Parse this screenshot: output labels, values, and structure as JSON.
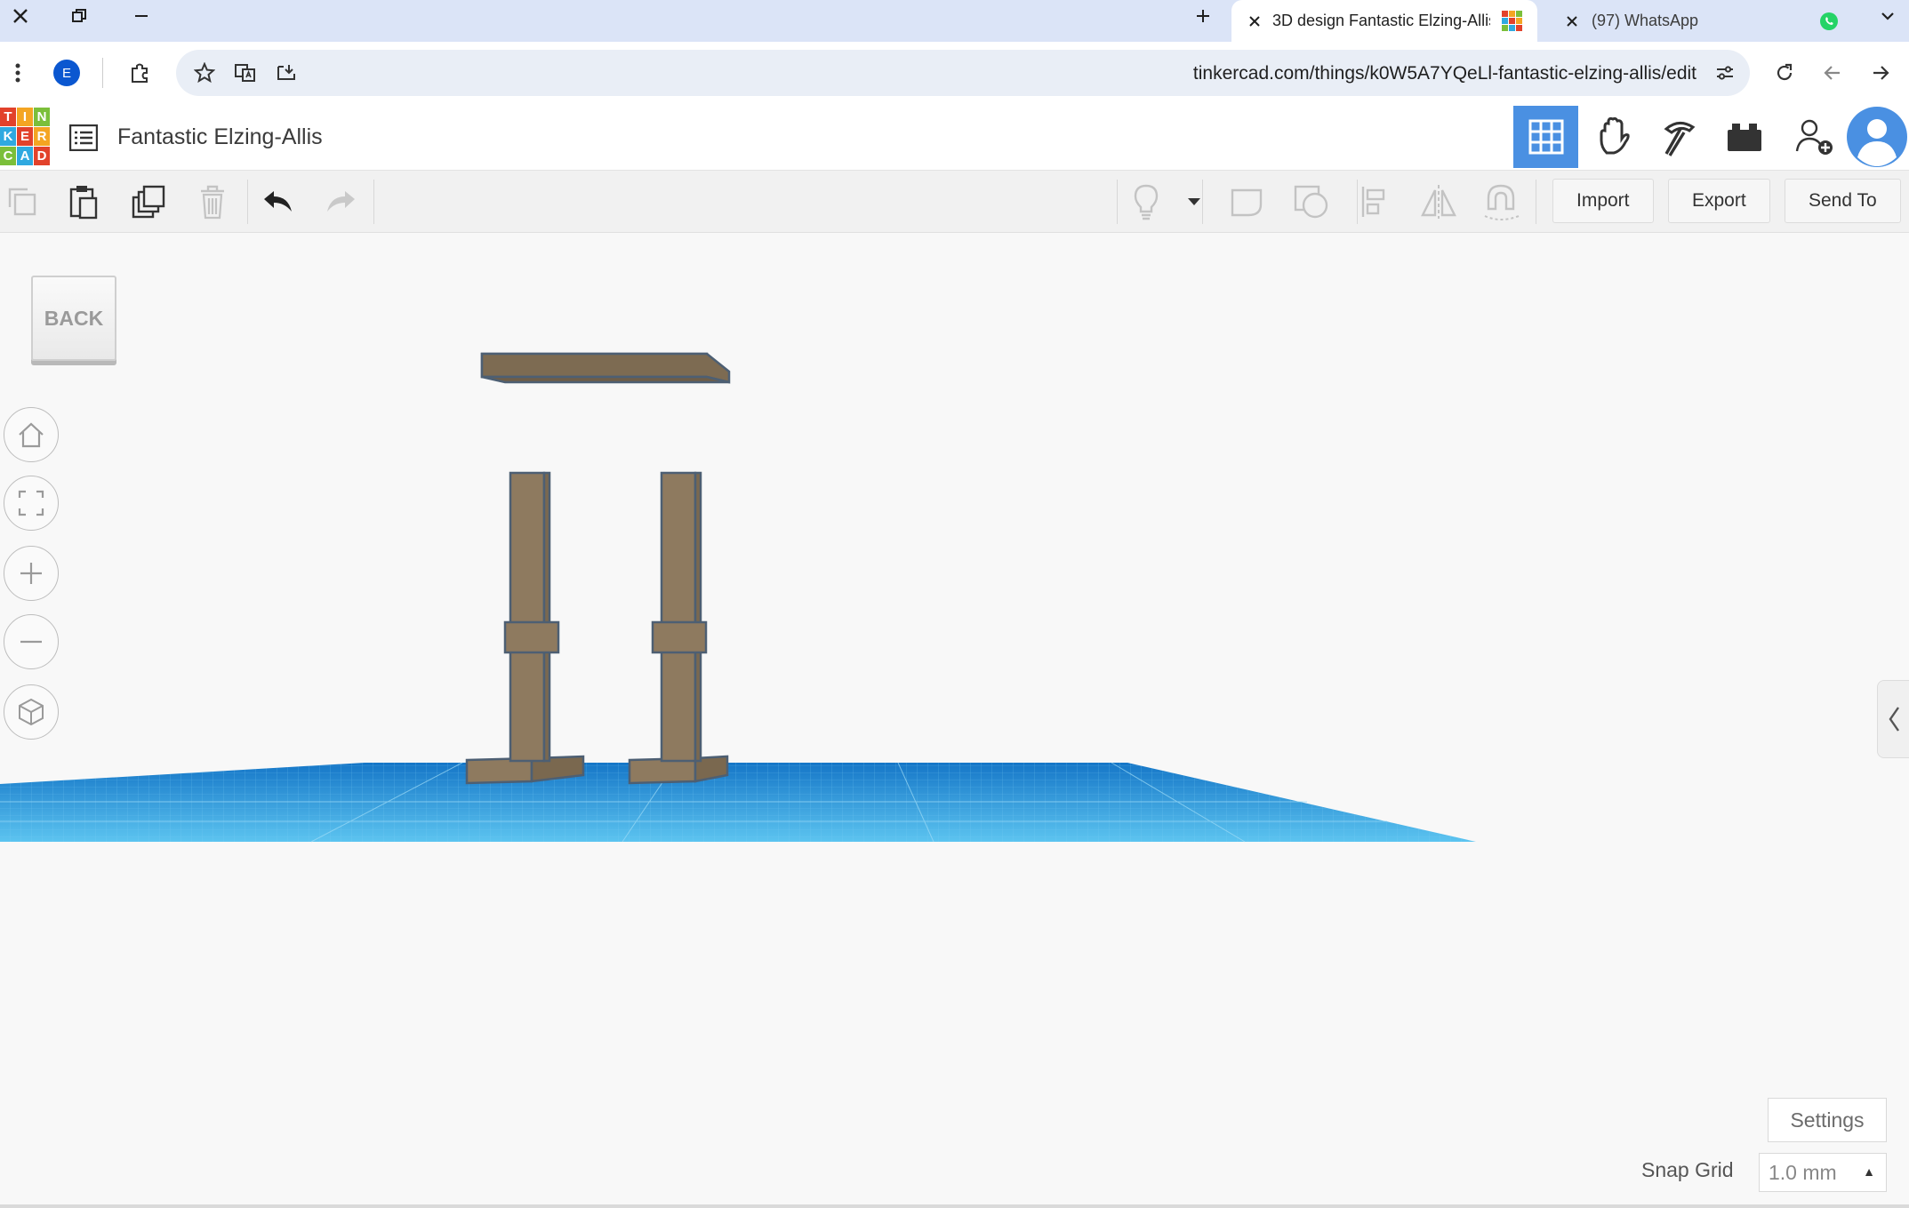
{
  "browser": {
    "tabs": [
      {
        "label": "3D design Fantastic Elzing-Allis",
        "active": true
      },
      {
        "label": "(97) WhatsApp",
        "active": false
      }
    ],
    "profile_initial": "E",
    "url": "tinkercad.com/things/k0W5A7YQeLl-fantastic-elzing-allis/edit"
  },
  "header": {
    "logo_letters": [
      "T",
      "I",
      "N",
      "K",
      "E",
      "R",
      "C",
      "A",
      "D"
    ],
    "logo_colors": [
      "#e2422b",
      "#f4a522",
      "#7bbf3a",
      "#2fa9e0",
      "#e2422b",
      "#f4a522",
      "#7bbf3a",
      "#2fa9e0",
      "#e2422b"
    ],
    "design_title": "Fantastic Elzing-Allis"
  },
  "toolbar": {
    "import_label": "Import",
    "export_label": "Export",
    "send_to_label": "Send To"
  },
  "workplane": {
    "back_label": "BACK",
    "settings_label": "Settings",
    "snap_grid_label": "Snap Grid",
    "snap_grid_value": "1.0 mm",
    "grid_color": "#2aa3df",
    "model_color": "#8e7a5f",
    "accent_color": "#4a90e2"
  }
}
